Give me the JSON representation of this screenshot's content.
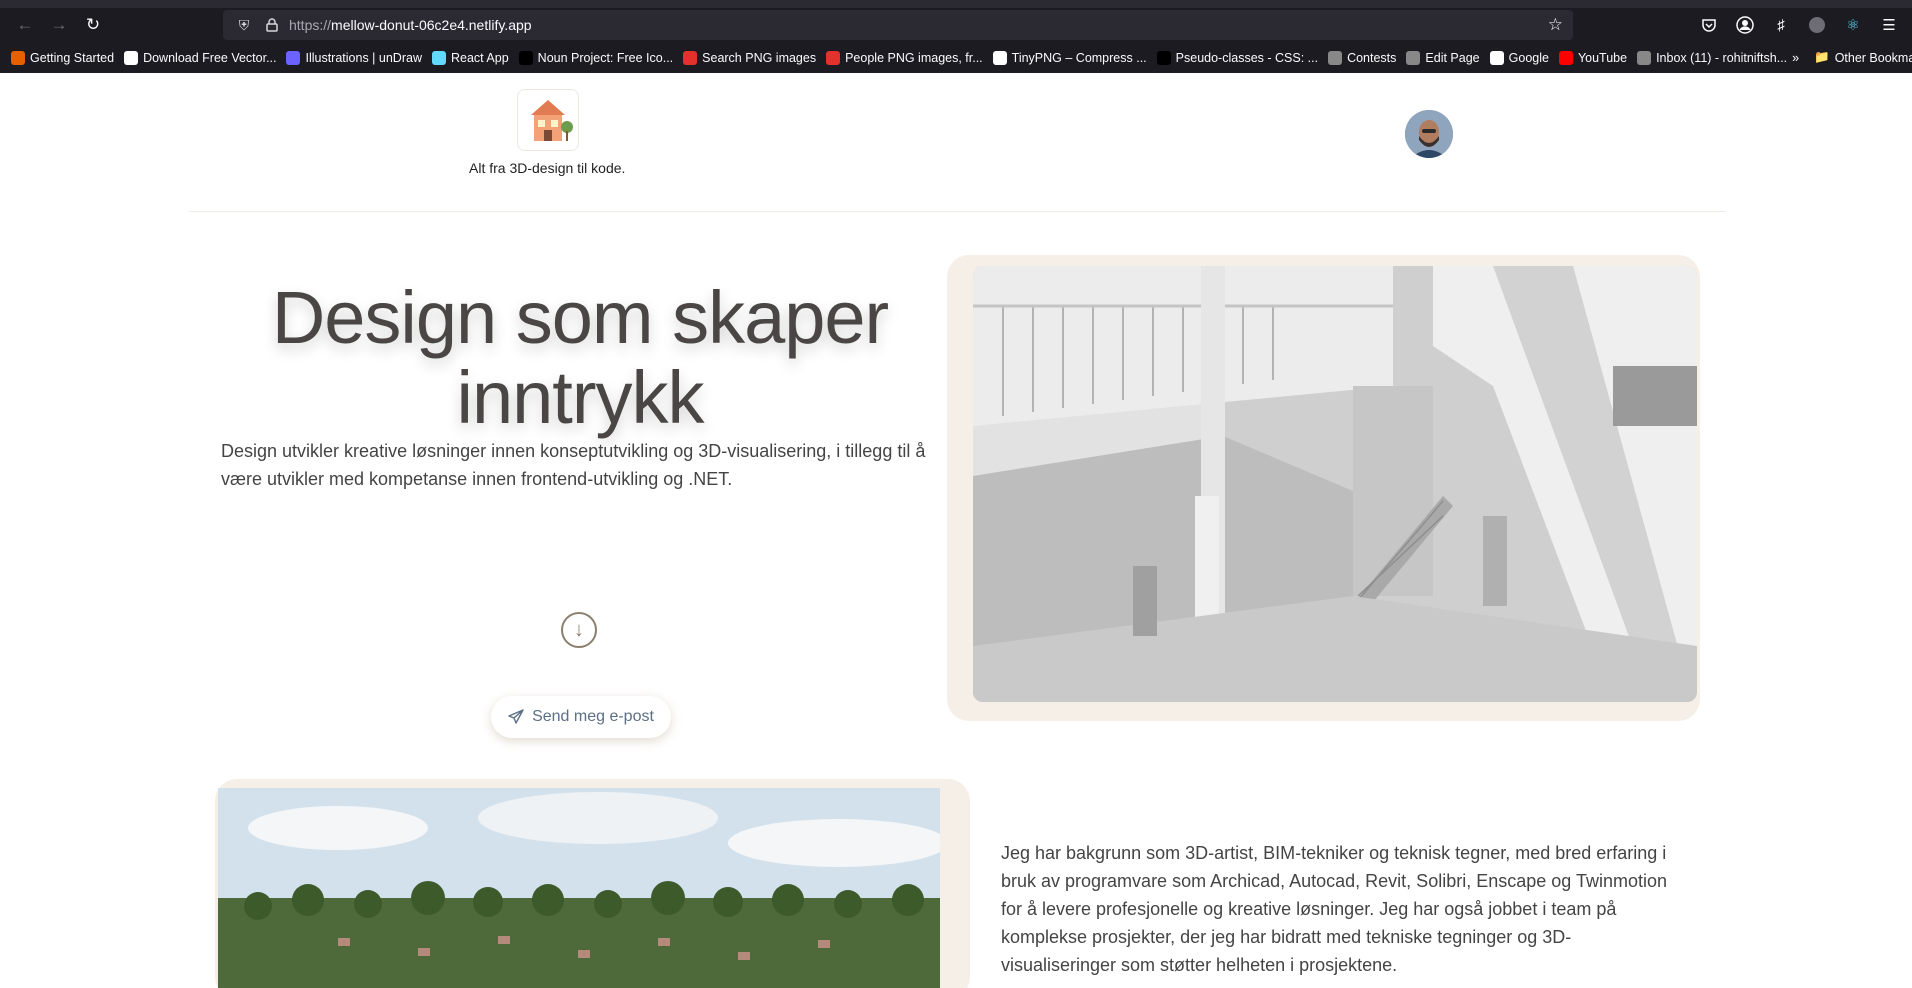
{
  "browser": {
    "url_proto": "https://",
    "url_host": "mellow-donut-06c2e4.netlify.app",
    "bookmarks": [
      {
        "label": "Getting Started",
        "color": "#e66000"
      },
      {
        "label": "Download Free Vector...",
        "color": "#ffffff"
      },
      {
        "label": "Illustrations | unDraw",
        "color": "#6c63ff"
      },
      {
        "label": "React App",
        "color": "#61dafb"
      },
      {
        "label": "Noun Project: Free Ico...",
        "color": "#000000"
      },
      {
        "label": "Search PNG images",
        "color": "#e4312b"
      },
      {
        "label": "People PNG images, fr...",
        "color": "#e4312b"
      },
      {
        "label": "TinyPNG – Compress ...",
        "color": "#ffffff"
      },
      {
        "label": "Pseudo-classes - CSS: ...",
        "color": "#000000"
      },
      {
        "label": "Contests",
        "color": "#888888"
      },
      {
        "label": "Edit Page",
        "color": "#888888"
      },
      {
        "label": "Google",
        "color": "#ffffff"
      },
      {
        "label": "YouTube",
        "color": "#ff0000"
      },
      {
        "label": "Inbox (11) - rohitniftsh...",
        "color": "#888888"
      }
    ],
    "other_bookmarks": "Other Bookmarks"
  },
  "header": {
    "tagline": "Alt fra 3D-design til kode."
  },
  "hero": {
    "title": "Design som skaper inntrykk",
    "description": "Design utvikler kreative løsninger innen konseptutvikling og 3D-visualisering, i tillegg til å være utvikler med kompetanse innen frontend-utvikling og .NET.",
    "mail_button": "Send meg e-post"
  },
  "about": {
    "text": "Jeg har bakgrunn som 3D-artist, BIM-tekniker og teknisk tegner, med bred erfaring i bruk av programvare som Archicad, Autocad, Revit, Solibri, Enscape og Twinmotion for å levere profesjonelle og kreative løsninger. Jeg har også jobbet i team på komplekse prosjekter, der jeg har bidratt med tekniske tegninger og 3D-visualiseringer som støtter helheten i prosjektene."
  }
}
